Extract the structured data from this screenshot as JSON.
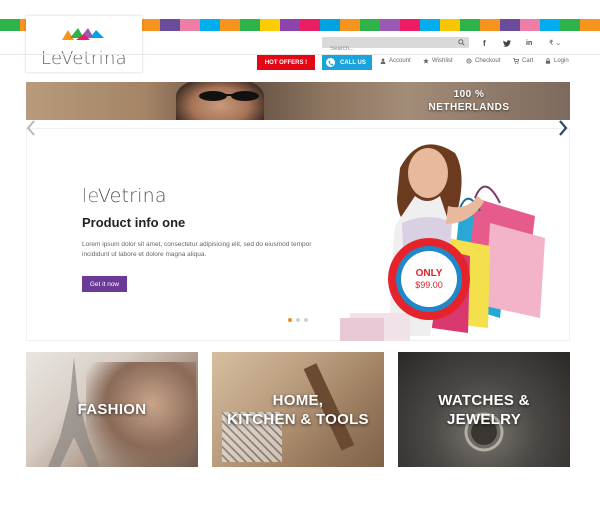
{
  "stripe_colors": [
    "#2eb34b",
    "#f7941d",
    "#9b59b6",
    "#ed1c64",
    "#00a3e0",
    "#f7c600",
    "#2eb34b",
    "#f7941d",
    "#6b4c9a",
    "#ec7ea8",
    "#00aeef",
    "#f7941d",
    "#2eb34b",
    "#ffcc00",
    "#8e44ad",
    "#e91e63",
    "#00a3e0",
    "#f7941d",
    "#2eb34b",
    "#9b59b6",
    "#ed1c64",
    "#00aeef",
    "#f7c600",
    "#2eb34b",
    "#f7941d",
    "#6b4c9a",
    "#ec7ea8",
    "#00aeef",
    "#2eb34b",
    "#f7941d"
  ],
  "brand": {
    "name": "LeVetrina"
  },
  "search": {
    "placeholder": "Search..."
  },
  "social": {
    "facebook": "f",
    "twitter": "twitter-icon",
    "linkedin": "in",
    "currency": "₹ ⌄"
  },
  "nav": {
    "hot_offers": "HOT OFFERS !",
    "call_us": "CALL US",
    "account": "Account",
    "wishlist": "Wishlist",
    "checkout": "Checkout",
    "cart": "Cart",
    "login": "Login"
  },
  "banner": {
    "line1": "100 %",
    "line2": "NETHERLANDS"
  },
  "hero": {
    "brand_prefix": "le",
    "brand_suffix": "Vetrina",
    "title": "Product info one",
    "description": "Lorem ipsum dolor sit amet, consectetur adipisicing elit, sed do eiusmod tempor incididunt ut labore et dolore magna aliqua.",
    "button": "Get it now",
    "badge_line1": "ONLY",
    "badge_line2": "$99.00",
    "active_slide": 1,
    "slide_count": 3
  },
  "categories": [
    {
      "label_line1": "FASHION",
      "label_line2": ""
    },
    {
      "label_line1": "HOME,",
      "label_line2": "KITCHEN & TOOLS"
    },
    {
      "label_line1": "WATCHES &",
      "label_line2": "JEWELRY"
    }
  ],
  "colors": {
    "hot": "#e30613",
    "call": "#1aa3dd",
    "button": "#6b3a98"
  }
}
